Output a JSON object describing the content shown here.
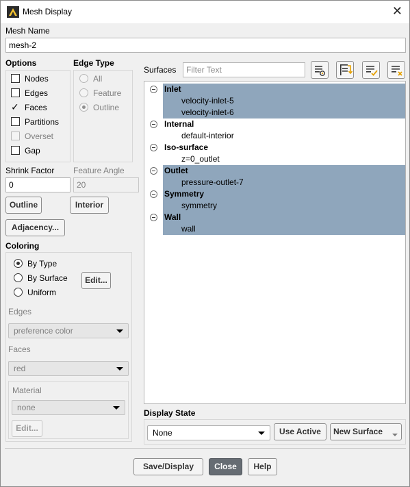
{
  "window": {
    "title": "Mesh Display"
  },
  "mesh_name": {
    "label": "Mesh Name",
    "value": "mesh-2"
  },
  "options": {
    "label": "Options",
    "items": [
      {
        "label": "Nodes",
        "checked": false,
        "enabled": true
      },
      {
        "label": "Edges",
        "checked": false,
        "enabled": true
      },
      {
        "label": "Faces",
        "checked": true,
        "enabled": true
      },
      {
        "label": "Partitions",
        "checked": false,
        "enabled": true
      },
      {
        "label": "Overset",
        "checked": false,
        "enabled": false
      },
      {
        "label": "Gap",
        "checked": false,
        "enabled": true
      }
    ]
  },
  "edge_type": {
    "label": "Edge Type",
    "items": [
      {
        "label": "All",
        "selected": false
      },
      {
        "label": "Feature",
        "selected": false
      },
      {
        "label": "Outline",
        "selected": true
      }
    ]
  },
  "shrink_factor": {
    "label": "Shrink Factor",
    "value": "0"
  },
  "feature_angle": {
    "label": "Feature Angle",
    "value": "20"
  },
  "buttons": {
    "outline": "Outline",
    "interior": "Interior",
    "adjacency": "Adjacency...",
    "edit_coloring": "Edit...",
    "edit_material": "Edit...",
    "use_active": "Use Active",
    "new_surface": "New Surface",
    "save_display": "Save/Display",
    "close": "Close",
    "help": "Help"
  },
  "coloring": {
    "label": "Coloring",
    "items": [
      {
        "label": "By Type",
        "selected": true
      },
      {
        "label": "By Surface",
        "selected": false
      },
      {
        "label": "Uniform",
        "selected": false
      }
    ],
    "edges_label": "Edges",
    "edges_value": "preference color",
    "faces_label": "Faces",
    "faces_value": "red",
    "material_label": "Material",
    "material_value": "none"
  },
  "surfaces": {
    "label": "Surfaces",
    "filter_placeholder": "Filter Text",
    "tree": [
      {
        "category": "Inlet",
        "selected": true,
        "children": [
          "velocity-inlet-5",
          "velocity-inlet-6"
        ]
      },
      {
        "category": "Internal",
        "selected": false,
        "children": [
          "default-interior"
        ]
      },
      {
        "category": "Iso-surface",
        "selected": false,
        "children": [
          "z=0_outlet"
        ]
      },
      {
        "category": "Outlet",
        "selected": true,
        "children": [
          "pressure-outlet-7"
        ]
      },
      {
        "category": "Symmetry",
        "selected": true,
        "children": [
          "symmetry"
        ]
      },
      {
        "category": "Wall",
        "selected": true,
        "children": [
          "wall"
        ]
      }
    ]
  },
  "display_state": {
    "label": "Display State",
    "value": "None"
  },
  "icons": {
    "filter_list": "list-filter-icon",
    "select_all": "select-all-icon",
    "check_selection": "check-selection-icon",
    "clear_selection": "clear-selection-icon"
  }
}
